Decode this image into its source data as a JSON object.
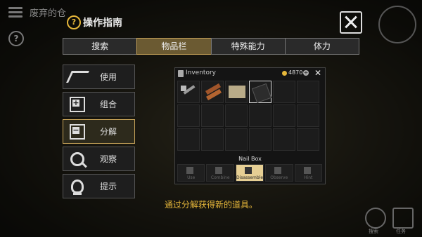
{
  "hud": {
    "title": "废弃的仓",
    "help": "?"
  },
  "guide": {
    "help": "?",
    "title": "操作指南"
  },
  "tabs": [
    {
      "label": "搜索"
    },
    {
      "label": "物品栏"
    },
    {
      "label": "特殊能力"
    },
    {
      "label": "体力"
    }
  ],
  "actions": [
    {
      "label": "使用",
      "icon": "hand-icon"
    },
    {
      "label": "组合",
      "icon": "combine-icon"
    },
    {
      "label": "分解",
      "icon": "disassemble-icon"
    },
    {
      "label": "观察",
      "icon": "magnifier-icon"
    },
    {
      "label": "提示",
      "icon": "bulb-icon"
    }
  ],
  "inventory": {
    "title": "Inventory",
    "coins": "4870",
    "items": [
      "hammer",
      "wood-planks",
      "paper-note",
      "nail-box"
    ],
    "selected_item_name": "Nail Box",
    "buttons": [
      {
        "label": "Use"
      },
      {
        "label": "Combine"
      },
      {
        "label": "Disassemble"
      },
      {
        "label": "Observe"
      },
      {
        "label": "Hint"
      }
    ]
  },
  "caption": "通过分解获得新的道具。",
  "bottom_right": {
    "left_label": "搜索",
    "right_label": "任务"
  },
  "colors": {
    "accent": "#e6b73a",
    "active_tab": "#6b5a32"
  }
}
